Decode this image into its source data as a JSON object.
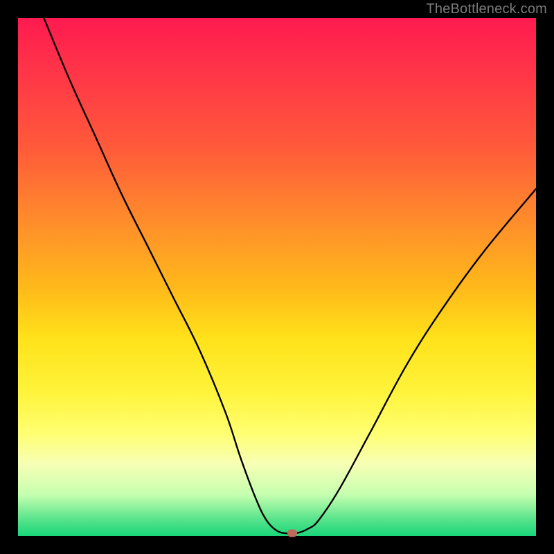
{
  "watermark": "TheBottleneck.com",
  "chart_data": {
    "type": "line",
    "title": "",
    "xlabel": "",
    "ylabel": "",
    "xlim": [
      0,
      100
    ],
    "ylim": [
      0,
      100
    ],
    "series": [
      {
        "name": "curve",
        "x": [
          5,
          10,
          15,
          20,
          25,
          30,
          35,
          40,
          43,
          46,
          48,
          50,
          52,
          54,
          56,
          58,
          62,
          68,
          75,
          82,
          90,
          100
        ],
        "values": [
          100,
          88,
          77,
          66,
          56,
          46,
          36,
          24,
          15,
          7,
          3,
          1,
          0.5,
          0.6,
          1.4,
          3,
          9,
          20,
          33,
          44,
          55,
          67
        ]
      }
    ],
    "marker": {
      "x": 53,
      "y": 0.5,
      "color": "#c06a5a"
    },
    "gradient_stops": [
      {
        "pos": 0,
        "color": "#ff1a4f"
      },
      {
        "pos": 25,
        "color": "#ff5a3a"
      },
      {
        "pos": 52,
        "color": "#ffb91a"
      },
      {
        "pos": 72,
        "color": "#fff33a"
      },
      {
        "pos": 92,
        "color": "#c6ffb0"
      },
      {
        "pos": 100,
        "color": "#19d67a"
      }
    ]
  }
}
